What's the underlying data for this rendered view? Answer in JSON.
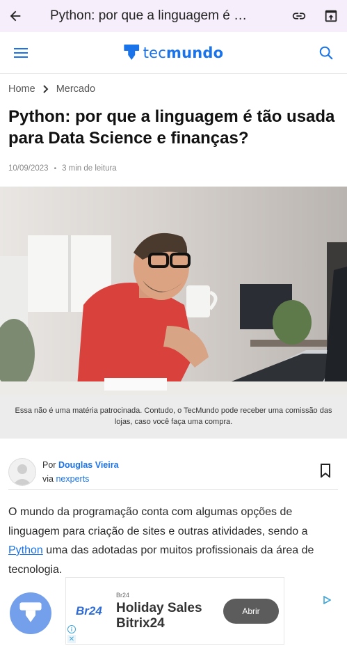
{
  "browser": {
    "title": "Python: por que a linguagem é …"
  },
  "site": {
    "logo_tec": "tec",
    "logo_mundo": "mundo"
  },
  "breadcrumb": [
    "Home",
    "Mercado"
  ],
  "article": {
    "title": "Python: por que a linguagem é tão usada para Data Science e finanças?",
    "date": "10/09/2023",
    "read_time": "3 min de leitura",
    "disclaimer": "Essa não é uma matéria patrocinada. Contudo, o TecMundo pode receber uma comissão das lojas, caso você faça uma compra.",
    "author_prefix": "Por",
    "author_name": "Douglas Vieira",
    "via_prefix": "via",
    "via_name": "nexperts",
    "body_before_link": "O mundo da programação conta com algumas opções de linguagem para criação de sites e outras atividades, sendo a ",
    "body_link": "Python",
    "body_after_link": " uma das adotadas por muitos profissionais da área de tecnologia."
  },
  "ad": {
    "brand": "Br24",
    "small_label": "Br24",
    "title": "Holiday Sales Bitrix24",
    "button": "Abrir",
    "info_glyph": "i",
    "close_glyph": "✕"
  },
  "icons": {
    "back": "back-arrow-icon",
    "link": "link-icon",
    "share": "share-icon",
    "menu": "menu-icon",
    "search": "search-icon",
    "breadcrumb_sep": "chevron-right-icon",
    "bookmark": "bookmark-icon"
  },
  "colors": {
    "accent": "#1a73e8",
    "browser_bar": "#f6eefa",
    "disclaimer_bg": "#ececec"
  }
}
